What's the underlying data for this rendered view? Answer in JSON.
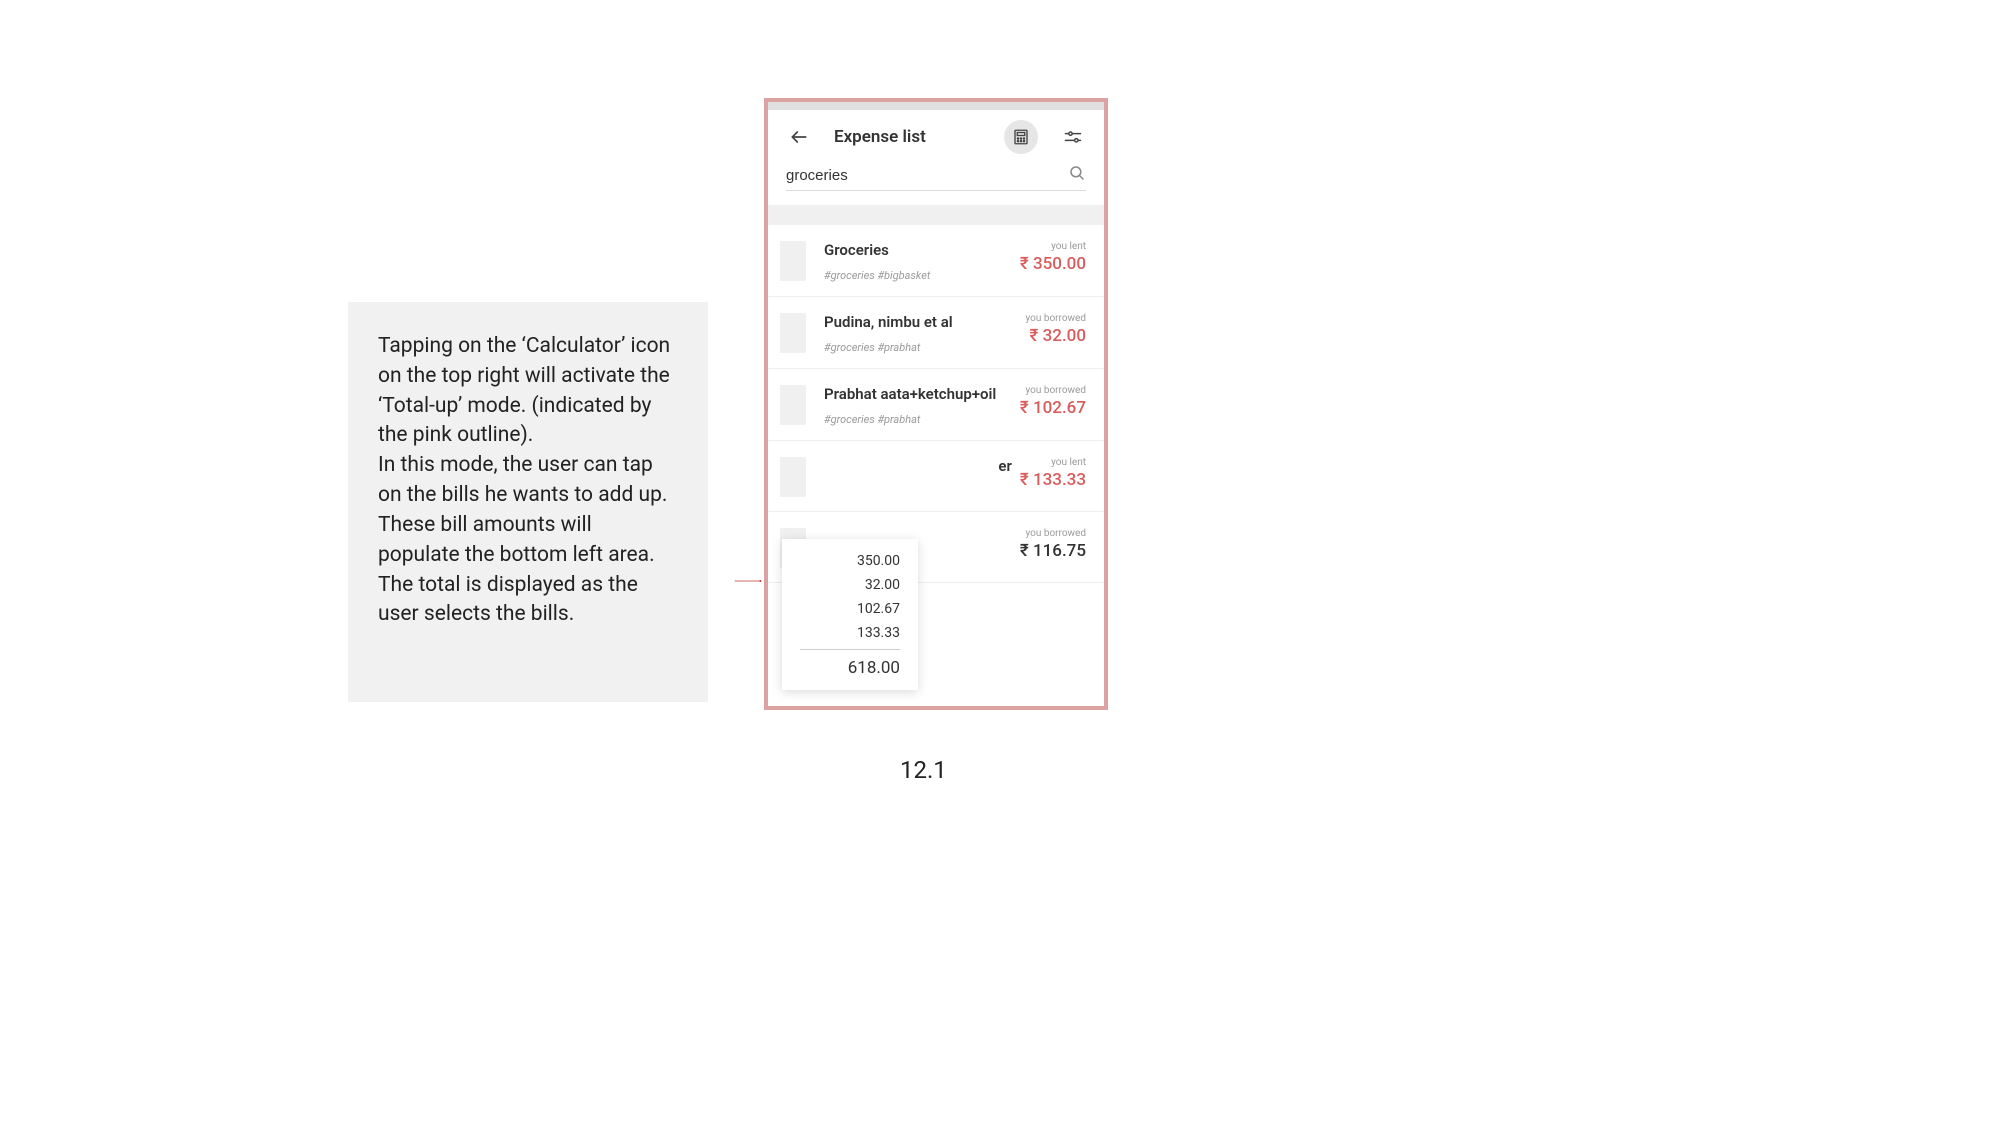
{
  "description": "Tapping on the ‘Calculator’ icon on the top right will activate the ‘Total-up’ mode. (indicated by the pink outline).\nIn this mode, the user can tap on the bills he wants to add up. These bill amounts will populate the bottom left area. The total is displayed as the user selects the bills.",
  "header": {
    "title": "Expense list"
  },
  "search": {
    "value": "groceries"
  },
  "colors": {
    "outline": "#dba2a2",
    "accent_red": "#d85c5c"
  },
  "rows": [
    {
      "title": "Groceries",
      "tags": "#groceries   #bigbasket",
      "status": "you lent",
      "amount": "₹ 350.00",
      "highlight": true
    },
    {
      "title": "Pudina, nimbu et al",
      "tags": "#groceries   #prabhat",
      "status": "you borrowed",
      "amount": "₹ 32.00",
      "highlight": true
    },
    {
      "title": "Prabhat aata+ketchup+oil",
      "tags": "#groceries   #prabhat",
      "status": "you borrowed",
      "amount": "₹ 102.67",
      "highlight": true
    },
    {
      "title": "er",
      "tags": "",
      "status": "you lent",
      "amount": "₹ 133.33",
      "highlight": true
    },
    {
      "title": "",
      "tags": "",
      "status": "you borrowed",
      "amount": "₹ 116.75",
      "highlight": false
    }
  ],
  "totalup": {
    "lines": [
      "350.00",
      "32.00",
      "102.67",
      "133.33"
    ],
    "total": "618.00"
  },
  "figure_label": "12.1"
}
